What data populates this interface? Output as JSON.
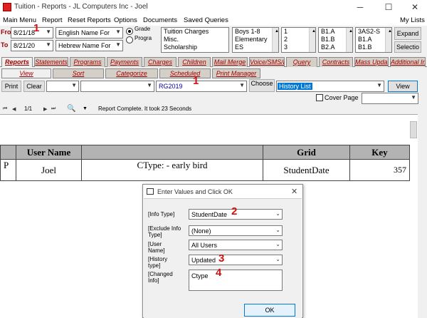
{
  "window": {
    "title": "Tuition - Reports - JL Computers Inc - Joel",
    "minimize": "─",
    "maximize": "☐",
    "close": "✕"
  },
  "menu": {
    "items": [
      "Main Menu",
      "Report",
      "Reset Reports",
      "Options",
      "Documents",
      "Saved Queries"
    ],
    "right": "My Lists"
  },
  "filters": {
    "from_label": "Fro",
    "to_label": "To",
    "from_date": "8/21/18",
    "to_date": "8/21/20",
    "name_format_1": "English Name For",
    "name_format_2": "Hebrew Name For",
    "radio_grade": "Grade",
    "radio_program": "Progra",
    "charges_list": [
      "Tuition Charges",
      "Misc.",
      "Scholarship"
    ],
    "school_list": [
      "Boys 1-8",
      "Elementary",
      "ES"
    ],
    "number_list": [
      "1",
      "2",
      "3"
    ],
    "class_list_1": [
      "B1.A",
      "B1.B",
      "B2.A"
    ],
    "class_list_2": [
      "3AS2-S",
      "B1.A",
      "B1.B"
    ],
    "expand_label": "Expand",
    "clear_label": "Clear",
    "selection_label": "Selectio"
  },
  "tabs": [
    "Reports",
    "Statements",
    "Programs",
    "Payments",
    "Charges",
    "Children",
    "Mail Merge",
    "Voice/SMS/Email",
    "Query",
    "Contracts",
    "Mass Update",
    "Additional Info"
  ],
  "subtabs": [
    "View",
    "Sort",
    "Categorize",
    "Scheduled",
    "Print Manager"
  ],
  "toolbar": {
    "print": "Print",
    "clear": "Clear",
    "report_code": "RG2019",
    "choose": "Choose",
    "report_name": "History List",
    "view": "View",
    "cover_page": "Cover Page"
  },
  "viewer": {
    "page": "1/1",
    "status": "Report Complete. It took 23 Seconds"
  },
  "report": {
    "headers": [
      "User Name",
      "",
      "Grid",
      "Key"
    ],
    "row": {
      "col0": "P",
      "user": "Joel",
      "ctype": "CType:   - early bird",
      "grid": "StudentDate",
      "key": "357"
    }
  },
  "dialog": {
    "title": "Enter Values and Click OK",
    "fields": [
      {
        "label": "[Info Type]",
        "value": "StudentDate"
      },
      {
        "label": "[Exclude Info Type]",
        "value": "(None)"
      },
      {
        "label": "[User Name]",
        "value": "All Users"
      },
      {
        "label": "[History type]",
        "value": "Updated"
      },
      {
        "label": "[Changed Info]",
        "value": "Ctype"
      }
    ],
    "ok": "OK"
  },
  "annotations": [
    "1",
    "1",
    "2",
    "3",
    "4"
  ],
  "colors": {
    "accent": "#a00000",
    "annotation": "#d01010",
    "highlight": "#0078d7"
  }
}
